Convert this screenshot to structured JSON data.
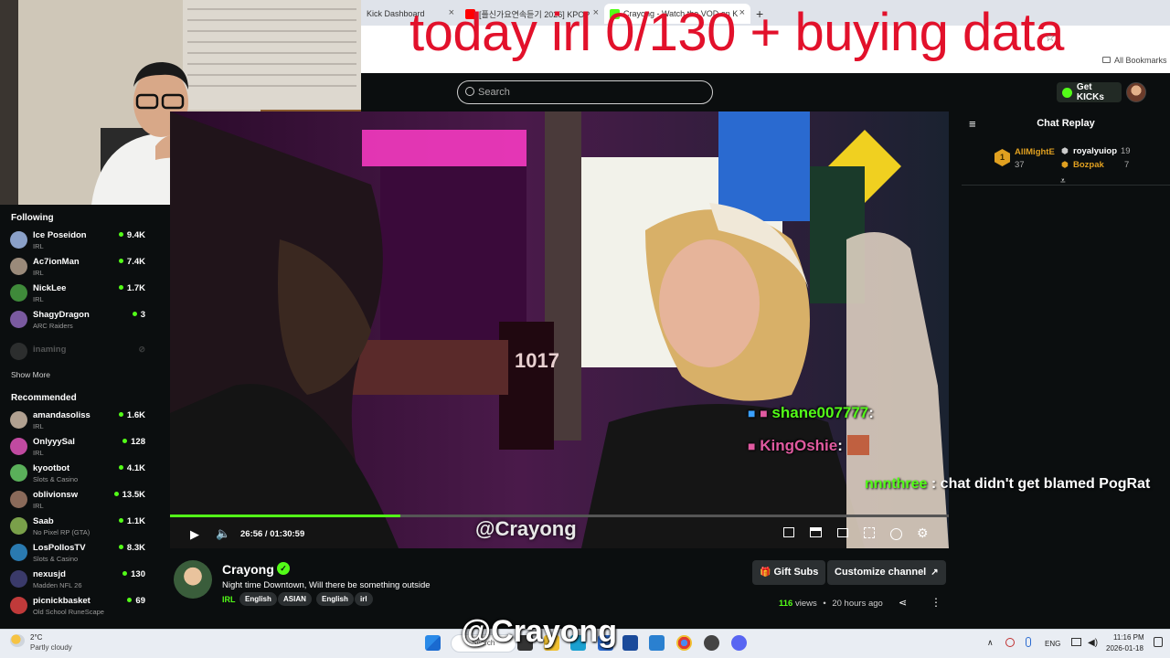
{
  "overlay": {
    "title": "today irl 0/130 + buying data",
    "bottom_watermark": "@Crayong",
    "video_watermark": "@Crayong"
  },
  "browser": {
    "tabs": [
      {
        "label": "Kick Dashboard"
      },
      {
        "label": "[플신가요연속듣기 2026] KPOP"
      },
      {
        "label": "Crayong - Watch the VOD on K"
      }
    ],
    "new_tab": "+",
    "bookmarks_label": "All Bookmarks"
  },
  "kick_header": {
    "search_placeholder": "Search",
    "get_kicks_label": "Get KICKs"
  },
  "sidebar": {
    "following_title": "Following",
    "following": [
      {
        "name": "Ice Poseidon",
        "category": "IRL",
        "viewers": "9.4K",
        "color": "#8aa0c8"
      },
      {
        "name": "Ac7ionMan",
        "category": "IRL",
        "viewers": "7.4K",
        "color": "#9a8a7a"
      },
      {
        "name": "NickLee",
        "category": "IRL",
        "viewers": "1.7K",
        "color": "#3f8a3a"
      },
      {
        "name": "ShagyDragon",
        "category": "ARC Raiders",
        "viewers": "3",
        "color": "#7a5aa0"
      }
    ],
    "offline": {
      "name": "inaming",
      "color": "#555555"
    },
    "show_more": "Show More",
    "recommended_title": "Recommended",
    "recommended": [
      {
        "name": "amandasoliss",
        "category": "IRL",
        "viewers": "1.6K",
        "color": "#b0a090"
      },
      {
        "name": "OnlyyySal",
        "category": "IRL",
        "viewers": "128",
        "color": "#c04aa0"
      },
      {
        "name": "kyootbot",
        "category": "Slots & Casino",
        "viewers": "4.1K",
        "color": "#5ab05a"
      },
      {
        "name": "oblivionsw",
        "category": "IRL",
        "viewers": "13.5K",
        "color": "#8a6a5a"
      },
      {
        "name": "Saab",
        "category": "No Pixel RP (GTA)",
        "viewers": "1.1K",
        "color": "#7aa04a"
      },
      {
        "name": "LosPollosTV",
        "category": "Slots & Casino",
        "viewers": "8.3K",
        "color": "#2a7ab0"
      },
      {
        "name": "nexusjd",
        "category": "Madden NFL 26",
        "viewers": "130",
        "color": "#3a3a6a"
      },
      {
        "name": "picnickbasket",
        "category": "Old School RuneScape",
        "viewers": "69",
        "color": "#c03a3a"
      }
    ]
  },
  "video": {
    "timecode": "26:56 / 01:30:59",
    "progress": 0.296,
    "chat_overlay": [
      {
        "user": "shane007777",
        "sep": ":",
        "color": "#53fc18"
      },
      {
        "user": "KingOshie",
        "sep": ":",
        "color": "#e05aa0"
      }
    ]
  },
  "outside_chat": {
    "user": "nnnthree",
    "message": " : chat didn't get blamed PogRat"
  },
  "chat": {
    "title": "Chat Replay",
    "leaders": [
      {
        "rank": "1",
        "name": "AllMightE",
        "count": "37"
      },
      {
        "name": "royalyuiop",
        "count": "19"
      },
      {
        "name": "Bozpak",
        "count": "7"
      }
    ]
  },
  "stream": {
    "streamer": "Crayong",
    "title": "Night time Downtown, Will there be something outside",
    "category": "IRL",
    "tags": [
      "English",
      "ASIAN",
      "English",
      "irl"
    ],
    "gift_subs": "Gift Subs",
    "customize": "Customize channel",
    "views_count": "116",
    "views_label": "views",
    "time_ago": "20 hours ago"
  },
  "taskbar": {
    "temperature": "2°C",
    "weather": "Partly cloudy",
    "search": "Search",
    "language": "ENG",
    "time": "11:16 PM",
    "date": "2026-01-18"
  }
}
